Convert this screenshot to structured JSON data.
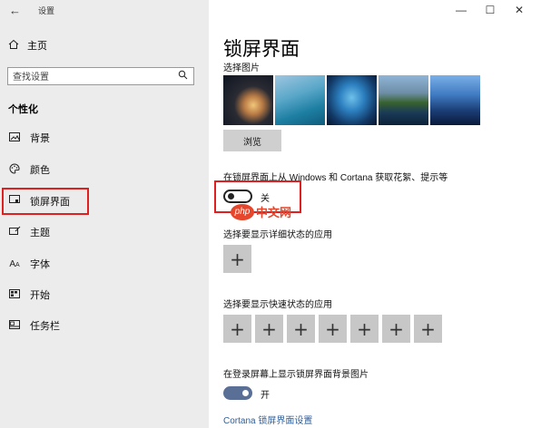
{
  "window": {
    "back_icon": "back-arrow-icon",
    "title": "设置",
    "controls": [
      "minimize-icon",
      "maximize-icon",
      "close-icon"
    ]
  },
  "sidebar": {
    "home_label": "主页",
    "search_placeholder": "查找设置",
    "section_title": "个性化",
    "items": [
      {
        "label": "背景",
        "icon": "picture-icon"
      },
      {
        "label": "颜色",
        "icon": "palette-icon"
      },
      {
        "label": "锁屏界面",
        "icon": "lockscreen-icon",
        "active": true
      },
      {
        "label": "主题",
        "icon": "theme-icon"
      },
      {
        "label": "字体",
        "icon": "font-icon"
      },
      {
        "label": "开始",
        "icon": "start-icon"
      },
      {
        "label": "任务栏",
        "icon": "taskbar-icon"
      }
    ]
  },
  "main": {
    "title": "锁屏界面",
    "choose_picture_label": "选择图片",
    "browse_label": "浏览",
    "fun_facts_label": "在锁屏界面上从 Windows 和 Cortana 获取花絮、提示等",
    "fun_facts_toggle": {
      "state": "off",
      "label": "关"
    },
    "detailed_status_label": "选择要显示详细状态的应用",
    "quick_status_label": "选择要显示快速状态的应用",
    "quick_status_slots": 7,
    "signin_bg_label": "在登录屏幕上显示锁屏界面背景图片",
    "signin_bg_toggle": {
      "state": "on",
      "label": "开"
    },
    "cortana_link": "Cortana 锁屏界面设置"
  },
  "watermark": {
    "badge": "php",
    "text": "中文网"
  },
  "colors": {
    "highlight": "#e02020",
    "toggle_on": "#5a6f96",
    "link": "#2f5f99"
  }
}
